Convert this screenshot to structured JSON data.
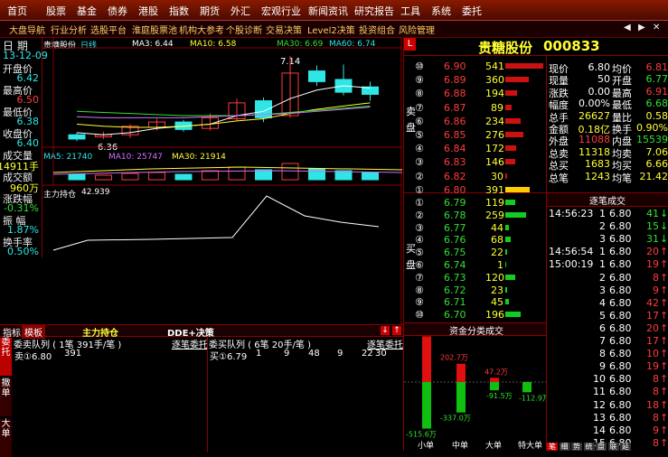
{
  "menu": [
    "首页",
    "股票",
    "基金",
    "债券",
    "港股",
    "指数",
    "期货",
    "外汇",
    "宏观行业",
    "新闻资讯",
    "研究报告",
    "工具",
    "系统",
    "委托"
  ],
  "toolbar": {
    "items": [
      "大盘导航",
      "行业分析",
      "选股平台",
      "淮庭股票池",
      "机构大参考",
      "个股诊断",
      "交易决策",
      "Level2决策",
      "投资组合",
      "风险管理"
    ],
    "window_buttons": [
      "◀",
      "▶",
      "✕"
    ]
  },
  "stock": {
    "name": "贵糖股份",
    "code": "000833",
    "chart_name": "贵糖股份",
    "period": "日线"
  },
  "ma_top": {
    "ma3": "MA3: 6.44",
    "ma10": "MA10: 6.58",
    "ma30": "MA30: 6.69",
    "ma60": "MA60: 6.74"
  },
  "ma_vol": {
    "ma5": "MA5: 21740",
    "ma10": "MA10: 25747",
    "ma30": "MA30: 21914"
  },
  "indicator": {
    "name": "主力持仓",
    "value": "42.939"
  },
  "chart_labels": {
    "high": "7.14",
    "low": "6.36"
  },
  "info": {
    "date_label": "日 期",
    "date": "13-12-09",
    "open_label": "开盘价",
    "open": "6.42",
    "high_label": "最高价",
    "high": "6.50",
    "low_label": "最低价",
    "low": "6.38",
    "close_label": "收盘价",
    "close": "6.40",
    "vol_label": "成交量",
    "vol": "14911手",
    "amt_label": "成交额",
    "amt": "960万",
    "chg_label": "涨跌幅",
    "chg": "-0.31%",
    "amp_label": "振 幅",
    "amp": "1.87%",
    "turn_label": "换手率",
    "turn": "0.50%"
  },
  "sell_side": {
    "label": "卖盘",
    "rows": [
      {
        "n": "⑩",
        "p": "6.90",
        "v": "541",
        "bar": 0.95
      },
      {
        "n": "⑨",
        "p": "6.89",
        "v": "360",
        "bar": 0.6
      },
      {
        "n": "⑧",
        "p": "6.88",
        "v": "194",
        "bar": 0.3
      },
      {
        "n": "⑦",
        "p": "6.87",
        "v": "89",
        "bar": 0.15
      },
      {
        "n": "⑥",
        "p": "6.86",
        "v": "234",
        "bar": 0.38
      },
      {
        "n": "⑤",
        "p": "6.85",
        "v": "276",
        "bar": 0.45
      },
      {
        "n": "④",
        "p": "6.84",
        "v": "172",
        "bar": 0.28
      },
      {
        "n": "③",
        "p": "6.83",
        "v": "146",
        "bar": 0.24
      },
      {
        "n": "②",
        "p": "6.82",
        "v": "30",
        "bar": 0.05
      },
      {
        "n": "①",
        "p": "6.80",
        "v": "391",
        "bar": 0.62
      }
    ]
  },
  "buy_side": {
    "label": "买盘",
    "rows": [
      {
        "n": "①",
        "p": "6.79",
        "v": "119",
        "bar": 0.3
      },
      {
        "n": "②",
        "p": "6.78",
        "v": "259",
        "bar": 0.6
      },
      {
        "n": "③",
        "p": "6.77",
        "v": "44",
        "bar": 0.1
      },
      {
        "n": "④",
        "p": "6.76",
        "v": "68",
        "bar": 0.16
      },
      {
        "n": "⑤",
        "p": "6.75",
        "v": "22",
        "bar": 0.05
      },
      {
        "n": "⑥",
        "p": "6.74",
        "v": "1",
        "bar": 0.01
      },
      {
        "n": "⑦",
        "p": "6.73",
        "v": "120",
        "bar": 0.3
      },
      {
        "n": "⑧",
        "p": "6.72",
        "v": "23",
        "bar": 0.05
      },
      {
        "n": "⑨",
        "p": "6.71",
        "v": "45",
        "bar": 0.1
      },
      {
        "n": "⑩",
        "p": "6.70",
        "v": "196",
        "bar": 0.45
      }
    ]
  },
  "quote_title": {
    "name": "贵糖股份",
    "code": "000833",
    "l_badge": "L"
  },
  "stats": [
    {
      "l1": "现价",
      "v1": "6.80",
      "c1": "wht",
      "l2": "均价",
      "v2": "6.81",
      "c2": "red"
    },
    {
      "l1": "现量",
      "v1": "50",
      "c1": "wht",
      "l2": "开盘",
      "v2": "6.77",
      "c2": "grn"
    },
    {
      "l1": "涨跌",
      "v1": "0.00",
      "c1": "wht",
      "l2": "最高",
      "v2": "6.91",
      "c2": "red"
    },
    {
      "l1": "幅度",
      "v1": "0.00%",
      "c1": "wht",
      "l2": "最低",
      "v2": "6.68",
      "c2": "grn"
    },
    {
      "l1": "总手",
      "v1": "26627",
      "c1": "yel",
      "l2": "量比",
      "v2": "0.58",
      "c2": "yel"
    },
    {
      "l1": "金额",
      "v1": "0.18亿",
      "c1": "yel",
      "l2": "换手",
      "v2": "0.90%",
      "c2": "yel"
    },
    {
      "l1": "外盘",
      "v1": "11088",
      "c1": "red",
      "l2": "内盘",
      "v2": "15539",
      "c2": "grn"
    },
    {
      "l1": "总卖",
      "v1": "11318",
      "c1": "yel",
      "l2": "均卖",
      "v2": "7.06",
      "c2": "yel"
    },
    {
      "l1": "总买",
      "v1": "1683",
      "c1": "yel",
      "l2": "均买",
      "v2": "6.66",
      "c2": "yel"
    },
    {
      "l1": "总笔",
      "v1": "1243",
      "c1": "yel",
      "l2": "均笔",
      "v2": "21.42",
      "c2": "yel"
    }
  ],
  "ticks_title": "逐笔成交",
  "ticks": [
    {
      "t": "14:56:23",
      "n": "1",
      "p": "6.80",
      "v": "41",
      "d": "↓",
      "c": "grn"
    },
    {
      "t": "",
      "n": "2",
      "p": "6.80",
      "v": "15",
      "d": "↓",
      "c": "grn"
    },
    {
      "t": "",
      "n": "3",
      "p": "6.80",
      "v": "31",
      "d": "↓",
      "c": "grn"
    },
    {
      "t": "14:56:54",
      "n": "1",
      "p": "6.80",
      "v": "20",
      "d": "↑",
      "c": "red"
    },
    {
      "t": "15:00:19",
      "n": "1",
      "p": "6.80",
      "v": "19",
      "d": "↑",
      "c": "red"
    },
    {
      "t": "",
      "n": "2",
      "p": "6.80",
      "v": "8",
      "d": "↑",
      "c": "red"
    },
    {
      "t": "",
      "n": "3",
      "p": "6.80",
      "v": "9",
      "d": "↑",
      "c": "red"
    },
    {
      "t": "",
      "n": "4",
      "p": "6.80",
      "v": "42",
      "d": "↑",
      "c": "red"
    },
    {
      "t": "",
      "n": "5",
      "p": "6.80",
      "v": "17",
      "d": "↑",
      "c": "red"
    },
    {
      "t": "",
      "n": "6",
      "p": "6.80",
      "v": "20",
      "d": "↑",
      "c": "red"
    },
    {
      "t": "",
      "n": "7",
      "p": "6.80",
      "v": "17",
      "d": "↑",
      "c": "red"
    },
    {
      "t": "",
      "n": "8",
      "p": "6.80",
      "v": "10",
      "d": "↑",
      "c": "red"
    },
    {
      "t": "",
      "n": "9",
      "p": "6.80",
      "v": "19",
      "d": "↑",
      "c": "red"
    },
    {
      "t": "",
      "n": "10",
      "p": "6.80",
      "v": "8",
      "d": "↑",
      "c": "red"
    },
    {
      "t": "",
      "n": "11",
      "p": "6.80",
      "v": "8",
      "d": "↑",
      "c": "red"
    },
    {
      "t": "",
      "n": "12",
      "p": "6.80",
      "v": "18",
      "d": "↑",
      "c": "red"
    },
    {
      "t": "",
      "n": "13",
      "p": "6.80",
      "v": "8",
      "d": "↑",
      "c": "red"
    },
    {
      "t": "",
      "n": "14",
      "p": "6.80",
      "v": "9",
      "d": "↑",
      "c": "red"
    },
    {
      "t": "",
      "n": "15",
      "p": "6.80",
      "v": "8",
      "d": "↑",
      "c": "red"
    }
  ],
  "bottom_tabs": {
    "indicator": "指标",
    "model": "模板",
    "main": "主力持仓",
    "dde": "DDE+决策"
  },
  "side_tabs": [
    "委托",
    "撤单",
    "大单"
  ],
  "sell_queue": {
    "title": "委卖队列 (  1笔   391手/笔 )",
    "link": "逐笔委托",
    "row": [
      "卖①6.80",
      "391"
    ]
  },
  "buy_queue": {
    "title": "委买队列 (  6笔   20手/笔 )",
    "link": "逐笔委托",
    "row": [
      "买①6.79",
      "1",
      "9",
      "48",
      "9",
      "22",
      "30"
    ]
  },
  "fund_flow": {
    "title": "资金分类成交",
    "categories": [
      "小单",
      "中单",
      "大单",
      "特大单"
    ],
    "inflow": [
      506.1,
      202.7,
      47.2,
      0
    ],
    "outflow": [
      -515.6,
      -337.0,
      -91.5,
      -112.9
    ],
    "labels_in": [
      "506.1万",
      "202.7万",
      "47.2万",
      ""
    ],
    "labels_out": [
      "-515.6万",
      "-337.0万",
      "-91.5万",
      "-112.9万"
    ]
  },
  "bottom_right_tabs": [
    "笔",
    "细",
    "势",
    "统",
    "盘",
    "联",
    "延"
  ],
  "candles": [
    {
      "o": 6.4,
      "c": 6.36,
      "h": 6.42,
      "l": 6.34
    },
    {
      "o": 6.38,
      "c": 6.4,
      "h": 6.43,
      "l": 6.36
    },
    {
      "o": 6.4,
      "c": 6.48,
      "h": 6.5,
      "l": 6.37
    },
    {
      "o": 6.47,
      "c": 6.52,
      "h": 6.55,
      "l": 6.44
    },
    {
      "o": 6.52,
      "c": 6.45,
      "h": 6.54,
      "l": 6.43
    },
    {
      "o": 6.46,
      "c": 6.56,
      "h": 6.6,
      "l": 6.44
    },
    {
      "o": 6.55,
      "c": 6.7,
      "h": 6.74,
      "l": 6.53
    },
    {
      "o": 6.72,
      "c": 6.56,
      "h": 6.75,
      "l": 6.52
    },
    {
      "o": 6.58,
      "c": 6.98,
      "h": 7.14,
      "l": 6.56
    },
    {
      "o": 7.0,
      "c": 6.9,
      "h": 7.05,
      "l": 6.86
    },
    {
      "o": 6.92,
      "c": 6.8,
      "h": 7.06,
      "l": 6.77
    },
    {
      "o": 6.85,
      "c": 6.78,
      "h": 6.9,
      "l": 6.72
    }
  ]
}
